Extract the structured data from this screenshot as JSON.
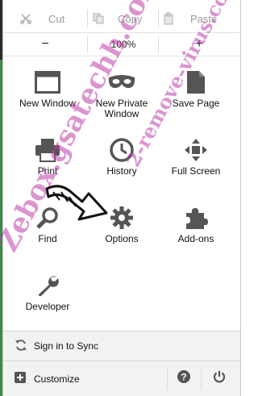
{
  "menu": {
    "edit": {
      "cut_label": "Cut",
      "copy_label": "Copy",
      "paste_label": "Paste"
    },
    "zoom": {
      "minus_label": "−",
      "level": "100%"
    },
    "tools": [
      {
        "label": "New Window",
        "icon": "window-icon"
      },
      {
        "label": "New Private Window",
        "icon": "mask-icon"
      },
      {
        "label": "Save Page",
        "icon": "page-icon"
      },
      {
        "label": "Print",
        "icon": "printer-icon"
      },
      {
        "label": "History",
        "icon": "clock-icon"
      },
      {
        "label": "Full Screen",
        "icon": "fullscreen-icon"
      },
      {
        "label": "Find",
        "icon": "magnifier-icon"
      },
      {
        "label": "Options",
        "icon": "gear-icon"
      },
      {
        "label": "Add-ons",
        "icon": "puzzle-icon"
      },
      {
        "label": "Developer",
        "icon": "wrench-icon"
      }
    ],
    "footer": {
      "sync_label": "Sign in to Sync",
      "customize_label": "Customize"
    }
  },
  "watermark": {
    "line1": "2-remove-virus.com",
    "line2": "Zebox.gsatechh.com"
  },
  "colors": {
    "panel_bg": "#ffffff",
    "footer_bg": "#f2f2f2",
    "icon_gray": "#5a5a5a",
    "watermark": "#be3caa"
  }
}
